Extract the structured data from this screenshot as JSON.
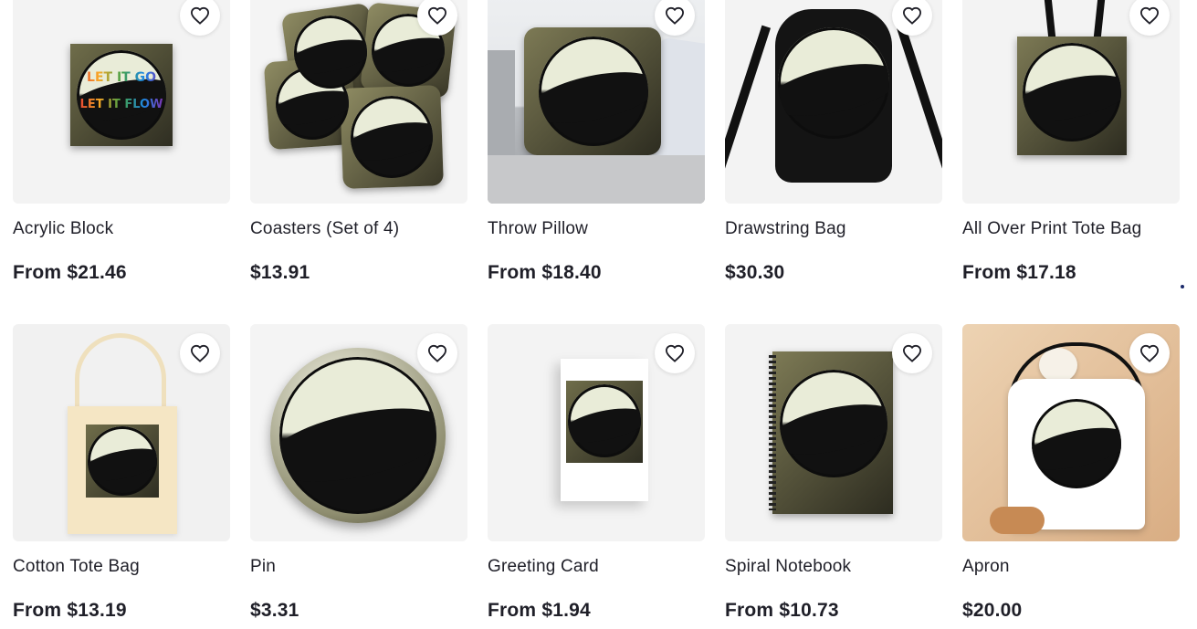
{
  "products": [
    {
      "title": "Acrylic Block",
      "price": "From $21.46",
      "bg": "#f3f3f3",
      "art": "block"
    },
    {
      "title": "Coasters (Set of 4)",
      "price": "$13.91",
      "bg": "#f4f4f4",
      "art": "coasters"
    },
    {
      "title": "Throw Pillow",
      "price": "From $18.40",
      "bg": "#d9d9db",
      "art": "pillow"
    },
    {
      "title": "Drawstring Bag",
      "price": "$30.30",
      "bg": "#f3f3f3",
      "art": "drawstring"
    },
    {
      "title": "All Over Print Tote Bag",
      "price": "From $17.18",
      "bg": "#f3f3f3",
      "art": "tote"
    },
    {
      "title": "Cotton Tote Bag",
      "price": "From $13.19",
      "bg": "#f1f1f1",
      "art": "cotton"
    },
    {
      "title": "Pin",
      "price": "$3.31",
      "bg": "#f4f4f4",
      "art": "pin"
    },
    {
      "title": "Greeting Card",
      "price": "From $1.94",
      "bg": "#f3f3f3",
      "art": "card"
    },
    {
      "title": "Spiral Notebook",
      "price": "From $10.73",
      "bg": "#f3f3f3",
      "art": "notebook"
    },
    {
      "title": "Apron",
      "price": "$20.00",
      "bg": "#e9c9a6",
      "art": "apron"
    }
  ],
  "design_text": {
    "line1": "LET IT GO",
    "line2": "LET IT FLOW"
  },
  "icons": {
    "favorite": "heart-outline-icon"
  }
}
